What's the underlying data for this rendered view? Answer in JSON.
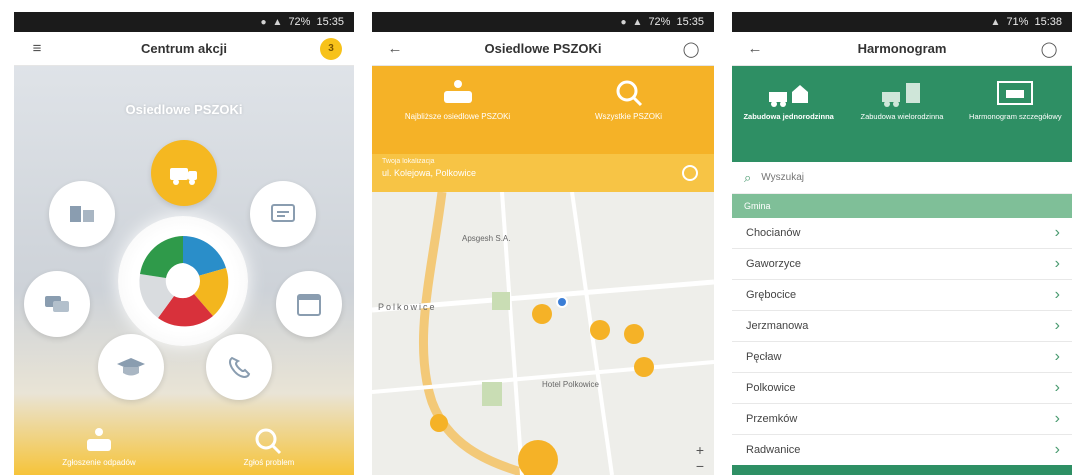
{
  "screens": [
    {
      "status": {
        "time": "15:35",
        "battery": "72%"
      },
      "title": "Centrum akcji",
      "badge": "3",
      "hub_title": "Osiedlowe PSZOKi",
      "bottom_items": [
        "Zgłoszenie odpadów",
        "Zgłoś problem"
      ]
    },
    {
      "status": {
        "time": "15:35",
        "battery": "72%"
      },
      "title": "Osiedlowe PSZOKi",
      "tiles": [
        "Najbliższe osiedlowe PSZOKi",
        "Wszystkie PSZOKi"
      ],
      "location": {
        "line1": "Twoja lokalizacja",
        "line2": "ul. Kolejowa, Polkowice"
      },
      "map_labels": [
        "Apsgesh S.A.",
        "Polkowice",
        "Hotel Polkowice"
      ],
      "zoom_in": "+",
      "zoom_out": "−"
    },
    {
      "status": {
        "time": "15:38",
        "battery": "71%"
      },
      "title": "Harmonogram",
      "tiles": [
        "Zabudowa jednorodzinna",
        "Zabudowa wielorodzinna",
        "Harmonogram szczegółowy"
      ],
      "search_placeholder": "Wyszukaj",
      "section": "Gmina",
      "rows": [
        "Chocianów",
        "Gaworzyce",
        "Grębocice",
        "Jerzmanowa",
        "Pęcław",
        "Polkowice",
        "Przemków",
        "Radwanice"
      ]
    }
  ],
  "colors": {
    "orange": "#f5b227",
    "green": "#2e8f64",
    "yellow": "#f7c21a"
  }
}
